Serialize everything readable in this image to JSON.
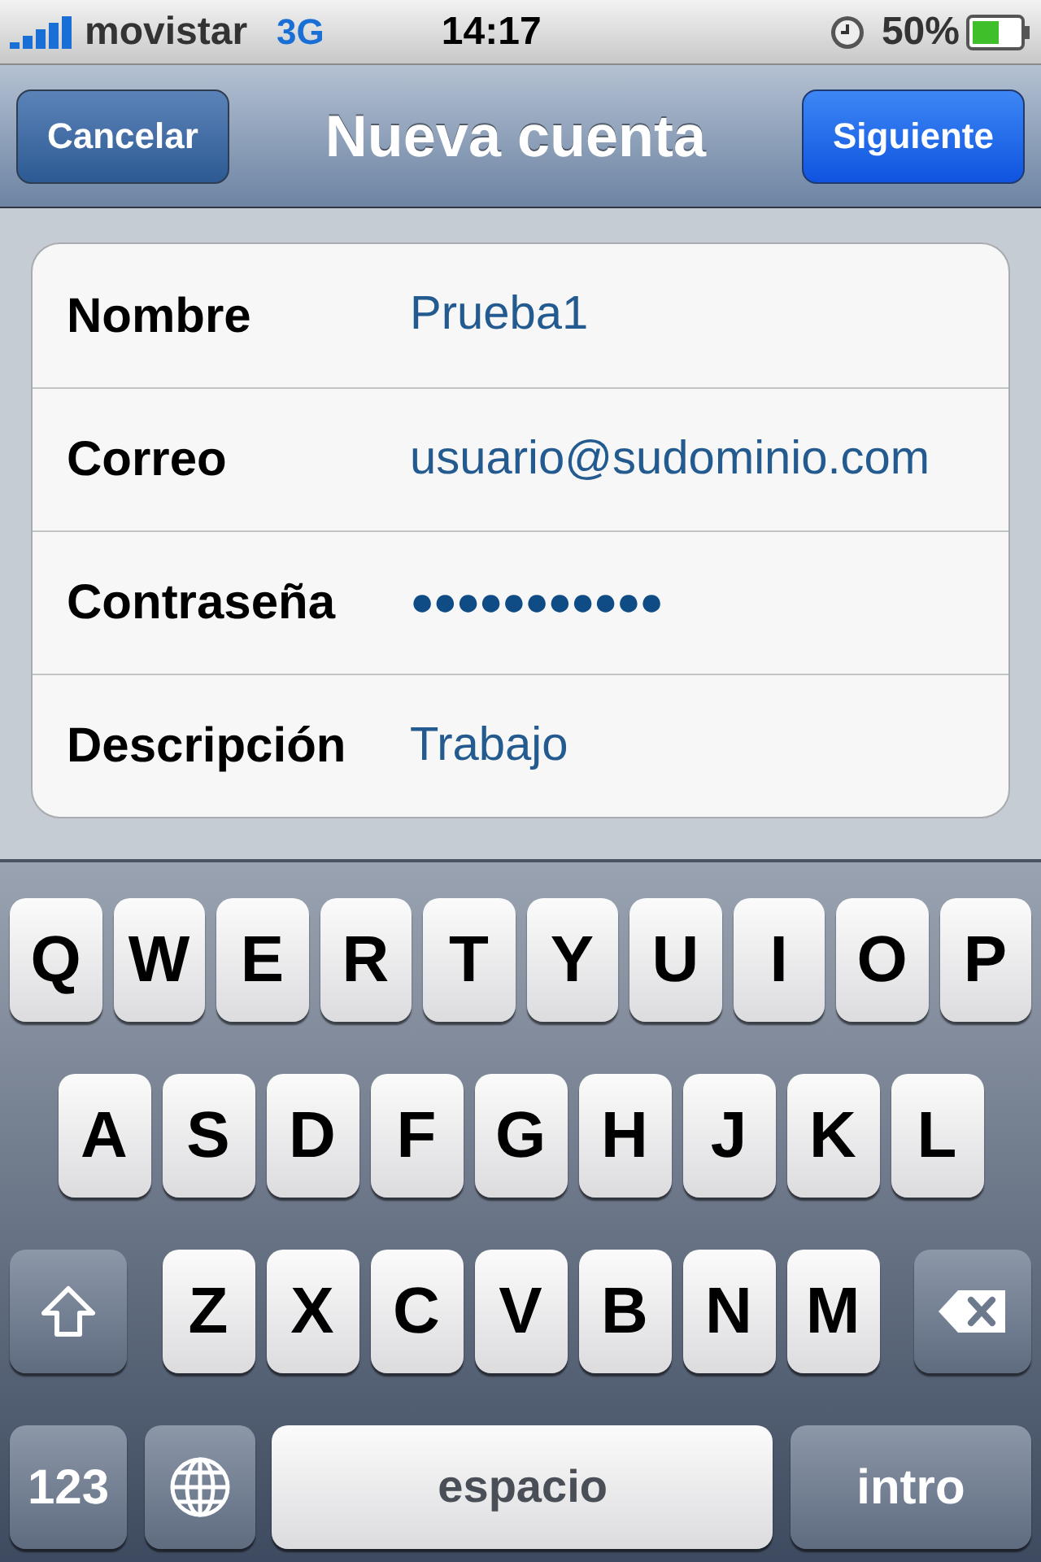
{
  "status_bar": {
    "carrier": "movistar",
    "network": "3G",
    "time": "14:17",
    "battery": "50%"
  },
  "nav_bar": {
    "cancel": "Cancelar",
    "title": "Nueva cuenta",
    "next": "Siguiente"
  },
  "form": {
    "rows": [
      {
        "label": "Nombre",
        "value": "Prueba1",
        "kind": "text"
      },
      {
        "label": "Correo",
        "value": "usuario@sudominio.com",
        "kind": "text"
      },
      {
        "label": "Contraseña",
        "value": "●●●●●●●●●●●",
        "kind": "password"
      },
      {
        "label": "Descripción",
        "value": "Trabajo",
        "kind": "text"
      }
    ]
  },
  "keyboard": {
    "letter_rows": [
      {
        "keys": [
          "Q",
          "W",
          "E",
          "R",
          "T",
          "Y",
          "U",
          "I",
          "O",
          "P"
        ]
      },
      {
        "keys": [
          "A",
          "S",
          "D",
          "F",
          "G",
          "H",
          "J",
          "K",
          "L"
        ]
      },
      {
        "keys": [
          "Z",
          "X",
          "C",
          "V",
          "B",
          "N",
          "M"
        ]
      }
    ],
    "numbers_key": "123",
    "space_key": "espacio",
    "return_key": "intro"
  }
}
